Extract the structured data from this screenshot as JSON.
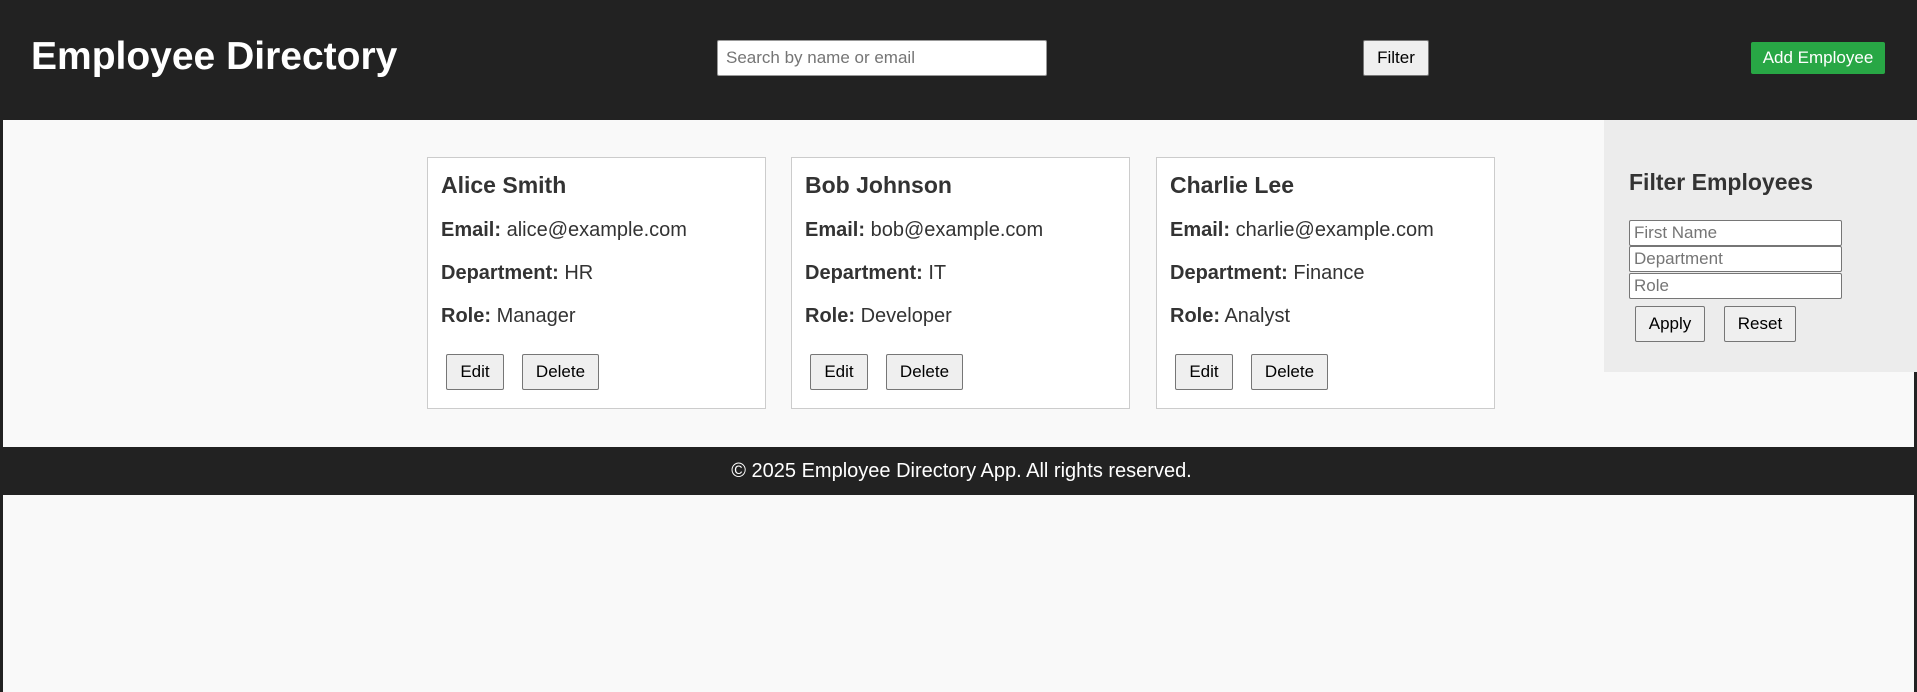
{
  "header": {
    "title": "Employee Directory",
    "search_placeholder": "Search by name or email",
    "filter_label": "Filter",
    "add_label": "Add Employee",
    "add_color": "#28a745",
    "background": "#222222"
  },
  "employees": [
    {
      "name": "Alice Smith",
      "email_label": "Email:",
      "email": "alice@example.com",
      "department_label": "Department:",
      "department": "HR",
      "role_label": "Role:",
      "role": "Manager",
      "edit_label": "Edit",
      "delete_label": "Delete"
    },
    {
      "name": "Bob Johnson",
      "email_label": "Email:",
      "email": "bob@example.com",
      "department_label": "Department:",
      "department": "IT",
      "role_label": "Role:",
      "role": "Developer",
      "edit_label": "Edit",
      "delete_label": "Delete"
    },
    {
      "name": "Charlie Lee",
      "email_label": "Email:",
      "email": "charlie@example.com",
      "department_label": "Department:",
      "department": "Finance",
      "role_label": "Role:",
      "role": "Analyst",
      "edit_label": "Edit",
      "delete_label": "Delete"
    }
  ],
  "sidebar": {
    "title": "Filter Employees",
    "first_name_placeholder": "First Name",
    "department_placeholder": "Department",
    "role_placeholder": "Role",
    "apply_label": "Apply",
    "reset_label": "Reset"
  },
  "footer": {
    "text": "© 2025 Employee Directory App. All rights reserved."
  }
}
